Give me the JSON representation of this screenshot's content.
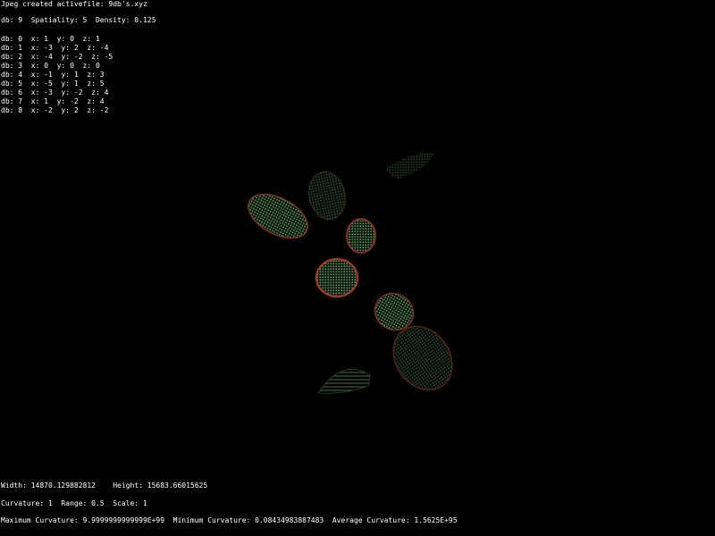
{
  "status_line": "Jpeg created activefile: 9db's.xyz",
  "summary_line": "db: 9  Spatiality: 5  Density: 0.125",
  "db_list": [
    "db: 0  x: 1  y: 0  z: 1",
    "db: 1  x: -3  y: 2  z: -4",
    "db: 2  x: -4  y: -2  z: -5",
    "db: 3  x: 0  y: 0  z: 0",
    "db: 4  x: -1  y: 1  z: 3",
    "db: 5  x: -5  y: 1  z: 5",
    "db: 6  x: -3  y: -2  z: 4",
    "db: 7  x: 1  y: -2  z: 4",
    "db: 8  x: -2  y: 2  z: -2"
  ],
  "dimensions_line": "Width: 14870.129882812    Height: 15683.66015625",
  "params_line": "Curvature: 1  Range: 0.5  Scale: 1",
  "curvature_line": "Maximum Curvature: 9.9999999999999E+99  Minimum Curvature: 0.08434983887483  Average Curvature: 1.5625E+95",
  "colors": {
    "background": "#000000",
    "text": "#ffffff",
    "point_green": "#4f8f52",
    "point_red": "#a3362a",
    "point_dim": "#2f4f33"
  }
}
